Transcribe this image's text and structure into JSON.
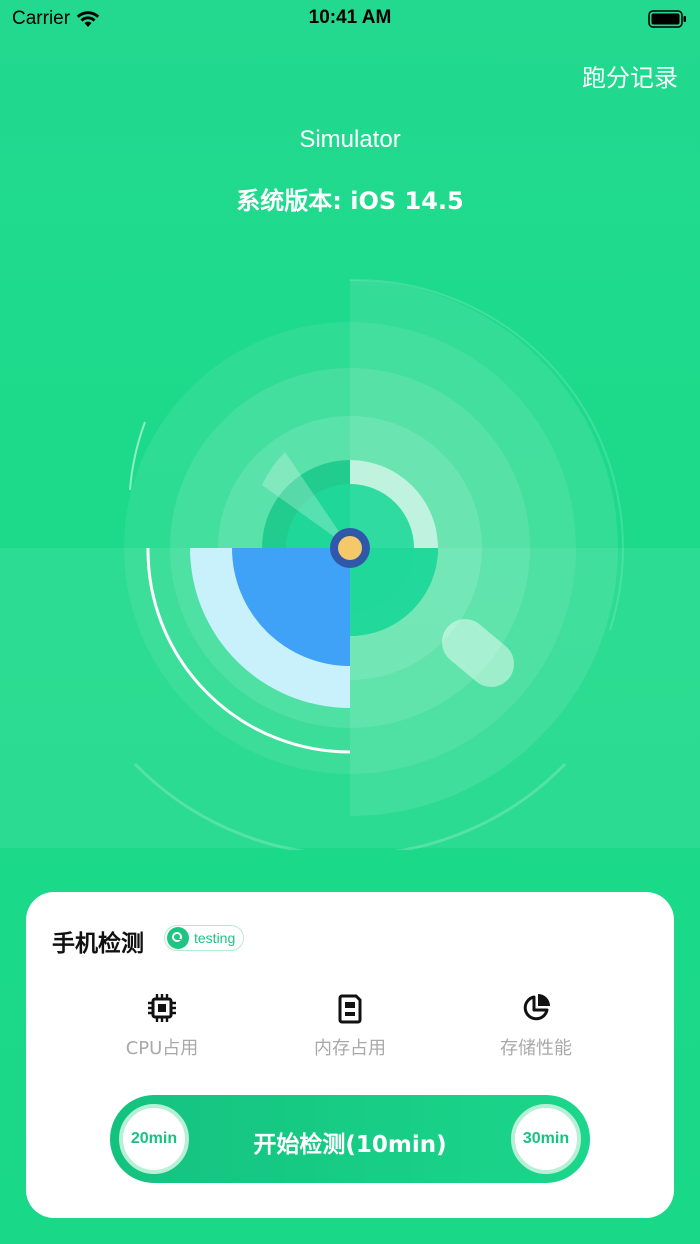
{
  "status_bar": {
    "carrier": "Carrier",
    "time": "10:41 AM"
  },
  "header": {
    "record_link": "跑分记录",
    "device_name": "Simulator",
    "os_version": "系统版本: iOS 14.5"
  },
  "card": {
    "title": "手机检测",
    "badge": "testing",
    "features": [
      {
        "label": "CPU占用",
        "icon": "cpu-icon"
      },
      {
        "label": "内存占用",
        "icon": "memory-card-icon"
      },
      {
        "label": "存储性能",
        "icon": "pie-chart-icon"
      }
    ],
    "start_button": "开始检测(10min)",
    "option_left": "20min",
    "option_right": "30min"
  },
  "colors": {
    "background": "#1cda8a",
    "accent": "#1dc583",
    "radar_blue": "#3fa2f7",
    "center_dot": "#f5c86a"
  }
}
